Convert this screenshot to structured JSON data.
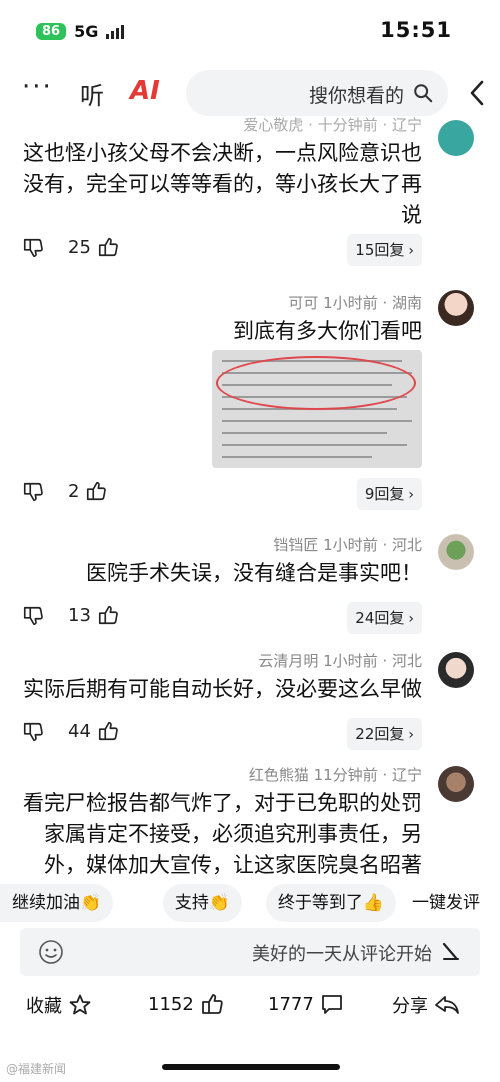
{
  "status_bar": {
    "time": "15:51",
    "network": "5G",
    "battery": "86"
  },
  "header": {
    "search_placeholder": "搜你想看的",
    "ai_label": "AI",
    "listen_label": "听",
    "more_label": "···"
  },
  "comments": [
    {
      "meta": "爱心敬虎 · 十分钟前 · 辽宁",
      "text": "这也怪小孩父母不会决断，一点风险意识也没有，完全可以等等看的，等小孩长大了再说",
      "likes": "25",
      "replies": "15回复"
    },
    {
      "meta": "可可  1小时前 · 湖南",
      "text": "到底有多大你们看吧",
      "likes": "2",
      "replies": "9回复"
    },
    {
      "meta": "铛铛匠  1小时前 · 河北",
      "text": "医院手术失误，没有缝合是事实吧！",
      "likes": "13",
      "replies": "24回复"
    },
    {
      "meta": "云清月明  1小时前 · 河北",
      "text": "实际后期有可能自动长好，没必要这么早做",
      "likes": "44",
      "replies": "22回复"
    },
    {
      "meta": "红色熊猫  11分钟前 · 辽宁",
      "text": "看完尸检报告都气炸了，对于已免职的处罚家属肯定不接受，必须追究刑事责任，另外，媒体加大宣传，让这家医院臭名昭著"
    }
  ],
  "chips": {
    "first": "一键发评",
    "items": [
      "终于等到了👍",
      "支持👏",
      "继续加油👏"
    ]
  },
  "input": {
    "placeholder": "美好的一天从评论开始"
  },
  "bottom_bar": {
    "share": "分享",
    "comments": "1777",
    "likes": "1152",
    "favorite": "收藏"
  },
  "watermark": "@福建新闻"
}
